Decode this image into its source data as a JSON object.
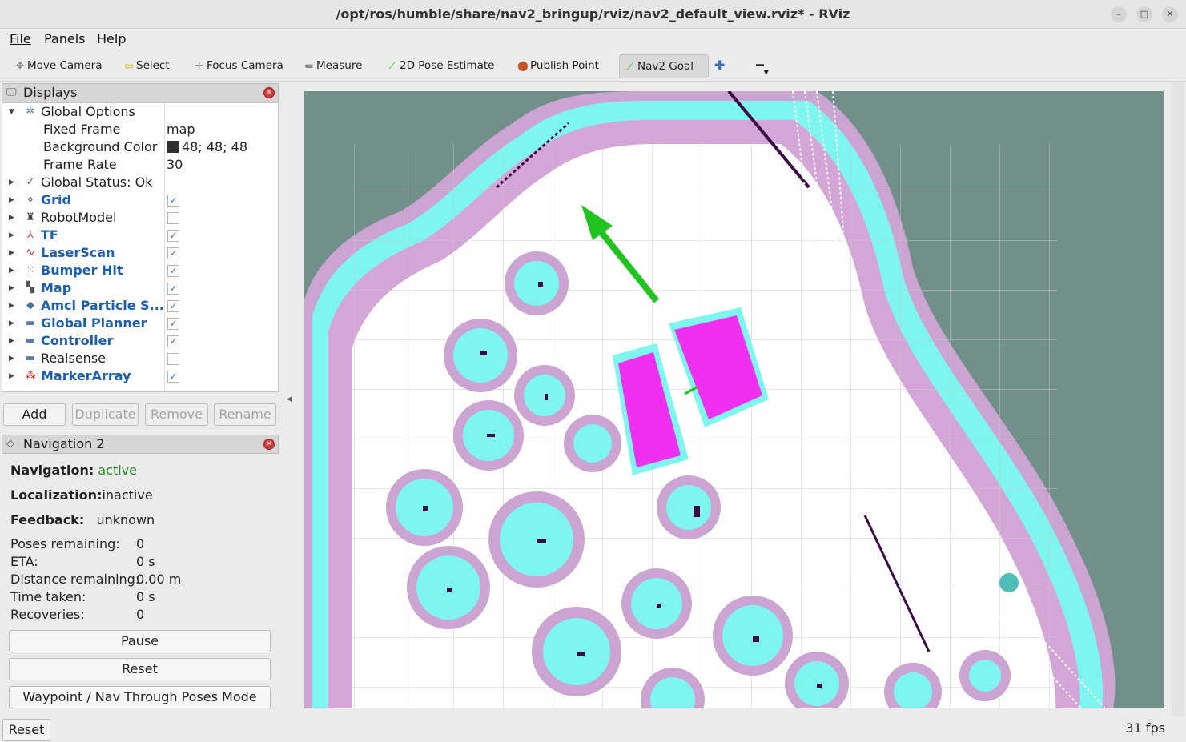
{
  "window": {
    "title": "/opt/ros/humble/share/nav2_bringup/rviz/nav2_default_view.rviz* - RViz",
    "min_icon": "minimize-icon",
    "max_icon": "maximize-icon",
    "close_icon": "close-icon"
  },
  "menu": [
    "File",
    "Panels",
    "Help"
  ],
  "toolbar": {
    "tools": [
      {
        "label": "Move Camera",
        "icon": "move-camera-icon"
      },
      {
        "label": "Select",
        "icon": "select-icon"
      },
      {
        "label": "Focus Camera",
        "icon": "focus-camera-icon"
      },
      {
        "label": "Measure",
        "icon": "measure-icon"
      },
      {
        "label": "2D Pose Estimate",
        "icon": "pose-estimate-icon"
      },
      {
        "label": "Publish Point",
        "icon": "publish-point-icon"
      },
      {
        "label": "Nav2 Goal",
        "icon": "nav2-goal-icon",
        "active": true
      }
    ],
    "add_icon": "plus-icon",
    "remove_icon": "minus-icon"
  },
  "displays": {
    "title": "Displays",
    "global_options": {
      "label": "Global Options",
      "fixed_frame_label": "Fixed Frame",
      "fixed_frame": "map",
      "background_color_label": "Background Color",
      "background_color": "48; 48; 48",
      "background_color_hex": "#303030",
      "frame_rate_label": "Frame Rate",
      "frame_rate": "30"
    },
    "global_status": "Global Status: Ok",
    "items": [
      {
        "label": "Grid",
        "checked": true
      },
      {
        "label": "RobotModel",
        "checked": false
      },
      {
        "label": "TF",
        "checked": true
      },
      {
        "label": "LaserScan",
        "checked": true
      },
      {
        "label": "Bumper Hit",
        "checked": true
      },
      {
        "label": "Map",
        "checked": true
      },
      {
        "label": "Amcl Particle S...",
        "checked": true
      },
      {
        "label": "Global Planner",
        "checked": true
      },
      {
        "label": "Controller",
        "checked": true
      },
      {
        "label": "Realsense",
        "checked": false
      },
      {
        "label": "MarkerArray",
        "checked": true
      }
    ],
    "buttons": {
      "add": "Add",
      "duplicate": "Duplicate",
      "remove": "Remove",
      "rename": "Rename"
    }
  },
  "navigation": {
    "title": "Navigation 2",
    "navigation_label": "Navigation:",
    "navigation_value": "active",
    "localization_label": "Localization:",
    "localization_value": "inactive",
    "feedback_label": "Feedback:",
    "feedback_value": "unknown",
    "stats": [
      {
        "label": "Poses remaining:",
        "value": "0"
      },
      {
        "label": "ETA:",
        "value": "0 s"
      },
      {
        "label": "Distance remaining:",
        "value": "0.00 m"
      },
      {
        "label": "Time taken:",
        "value": "0 s"
      },
      {
        "label": "Recoveries:",
        "value": "0"
      }
    ],
    "buttons": {
      "pause": "Pause",
      "reset": "Reset",
      "mode": "Waypoint / Nav Through Poses Mode"
    }
  },
  "statusbar": {
    "reset": "Reset",
    "fps": "31 fps"
  },
  "colors": {
    "map_unknown": "#72908a",
    "costmap_inflation": "#7ff5f0",
    "costmap_outer": "#d4a6d8",
    "goal_arrow": "#1fc41f",
    "robot_footprint": "#f030f0",
    "obstacle": "#3d0a45"
  }
}
